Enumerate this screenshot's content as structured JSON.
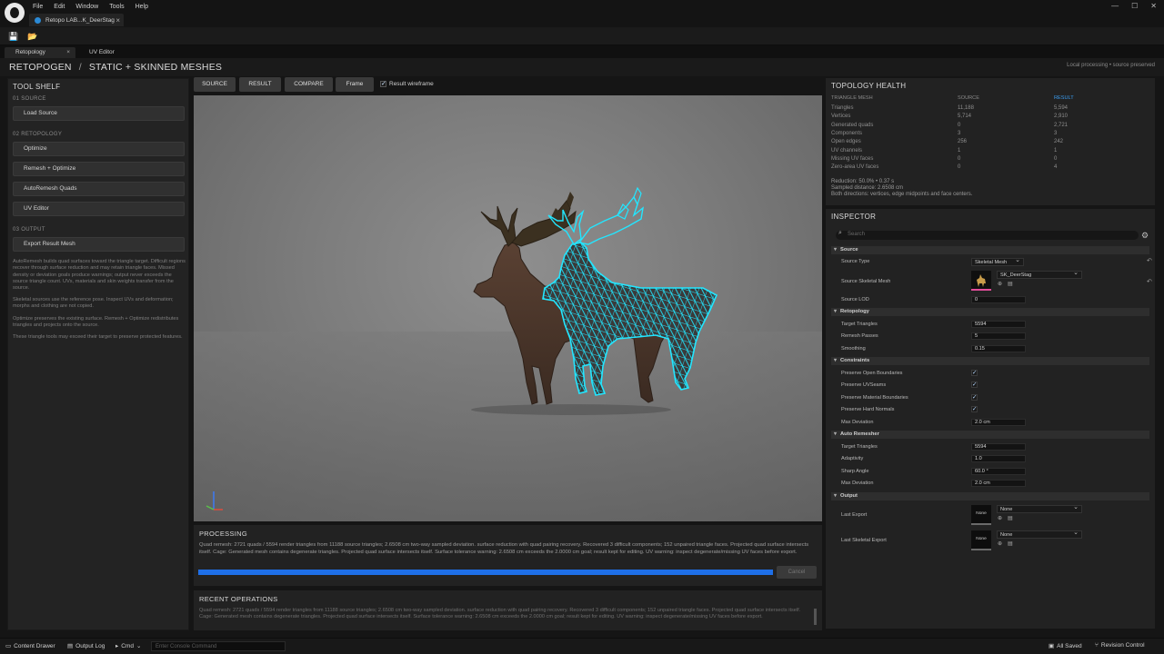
{
  "app": {
    "menu": [
      "File",
      "Edit",
      "Window",
      "Tools",
      "Help"
    ],
    "doc_tab": "Retopo LAB...K_DeerStag"
  },
  "panel_tabs": {
    "active": "Retopology",
    "inactive": "UV Editor"
  },
  "header": {
    "crumb_root": "RETOPOGEN",
    "crumb_sep": "/",
    "crumb_page": "STATIC + SKINNED MESHES",
    "status": "Local processing • source preserved"
  },
  "shelf": {
    "title": "TOOL SHELF",
    "sec_source": "01  SOURCE",
    "load_source": "Load Source",
    "sec_retopo": "02  RETOPOLOGY",
    "optimize": "Optimize",
    "remesh_optimize": "Remesh + Optimize",
    "autoremesh_quads": "AutoRemesh Quads",
    "uv_editor": "UV Editor",
    "sec_output": "03  OUTPUT",
    "export_result": "Export Result Mesh",
    "help1": "AutoRemesh builds quad surfaces toward the triangle target. Difficult regions recover through surface reduction and may retain triangle faces. Missed density or deviation goals produce warnings; output never exceeds the source triangle count. UVs, materials and skin weights transfer from the source.",
    "help2": "Skeletal sources use the reference pose. Inspect UVs and deformation; morphs and clothing are not copied.",
    "help3": "Optimize preserves the existing surface. Remesh + Optimize redistributes triangles and projects onto the source.",
    "help4": "These triangle tools may exceed their target to preserve protected features."
  },
  "viewport_tools": {
    "source": "SOURCE",
    "result": "RESULT",
    "compare": "COMPARE",
    "frame": "Frame",
    "wireframe": "Result wireframe"
  },
  "processing": {
    "title": "PROCESSING",
    "log": "Quad remesh: 2721 quads / 5594 render triangles from 11188 source triangles; 2.6508 cm two-way sampled deviation. surface reduction with quad pairing recovery. Recovered 3 difficult components; 152 unpaired triangle faces. Projected quad surface intersects itself. Cage: Generated mesh contains degenerate triangles. Projected quad surface intersects itself. Surface tolerance warning: 2.6508 cm exceeds the 2.0000 cm goal; result kept for editing. UV warning: inspect degenerate/missing UV faces before export.",
    "progress": 1.0,
    "cancel": "Cancel"
  },
  "recent": {
    "title": "RECENT OPERATIONS",
    "log": "Quad remesh: 2721 quads / 5594 render triangles from 11188 source triangles; 2.6508 cm two-way sampled deviation. surface reduction with quad pairing recovery. Recovered 3 difficult components; 152 unpaired triangle faces. Projected quad surface intersects itself. Cage: Generated mesh contains degenerate triangles. Projected quad surface intersects itself. Surface tolerance warning: 2.6508 cm exceeds the 2.0000 cm goal; result kept for editing. UV warning: inspect degenerate/missing UV faces before export."
  },
  "topology": {
    "title": "TOPOLOGY HEALTH",
    "head": {
      "c1": "TRIANGLE MESH",
      "c2": "SOURCE",
      "c3": "RESULT"
    },
    "rows": [
      {
        "label": "Triangles",
        "source": "11,188",
        "result": "5,594"
      },
      {
        "label": "Vertices",
        "source": "5,714",
        "result": "2,910"
      },
      {
        "label": "Generated quads",
        "source": "0",
        "result": "2,721"
      },
      {
        "label": "Components",
        "source": "3",
        "result": "3"
      },
      {
        "label": "Open edges",
        "source": "256",
        "result": "242"
      },
      {
        "label": "UV channels",
        "source": "1",
        "result": "1"
      },
      {
        "label": "Missing UV faces",
        "source": "0",
        "result": "0"
      },
      {
        "label": "Zero-area UV faces",
        "source": "0",
        "result": "4"
      }
    ],
    "note1": "Reduction: 50.0% • 0.37 s",
    "note2": "Sampled distance: 2.6508 cm",
    "note3": "Both directions: vertices, edge midpoints and face centers."
  },
  "inspector": {
    "title": "INSPECTOR",
    "search_placeholder": "Search",
    "cat_source": "Source",
    "source_type_label": "Source Type",
    "source_type": "Skeletal Mesh",
    "source_skel_label": "Source Skeletal Mesh",
    "source_skel": "SK_DeerStag",
    "source_lod_label": "Source LOD",
    "source_lod": "0",
    "cat_retopo": "Retopology",
    "target_tris_label": "Target Triangles",
    "target_tris": "5594",
    "remesh_passes_label": "Remesh Passes",
    "remesh_passes": "5",
    "smoothing_label": "Smoothing",
    "smoothing": "0.15",
    "cat_constraints": "Constraints",
    "pres_open_label": "Preserve Open Boundaries",
    "pres_uv_label": "Preserve UVSeams",
    "pres_mat_label": "Preserve Material Boundaries",
    "pres_hard_label": "Preserve Hard Normals",
    "max_dev_label": "Max Deviation",
    "max_dev": "2.0 cm",
    "cat_auto": "Auto Remesher",
    "ar_target_label": "Target Triangles",
    "ar_target": "5594",
    "adaptivity_label": "Adaptivity",
    "adaptivity": "1.0",
    "sharp_label": "Sharp Angle",
    "sharp": "60.0 °",
    "ar_maxdev_label": "Max Deviation",
    "ar_maxdev": "2.0 cm",
    "cat_output": "Output",
    "last_export_label": "Last Export",
    "last_export": "None",
    "last_skel_label": "Last Skeletal Export",
    "last_skel": "None",
    "thumb_none": "None"
  },
  "statusbar": {
    "content_drawer": "Content Drawer",
    "output_log": "Output Log",
    "cmd": "Cmd",
    "console_placeholder": "Enter Console Command",
    "all_saved": "All Saved",
    "revision": "Revision Control"
  },
  "colors": {
    "accent": "#1e6fe8",
    "wire": "#23e6ff",
    "result_head": "#3a9cf0"
  }
}
